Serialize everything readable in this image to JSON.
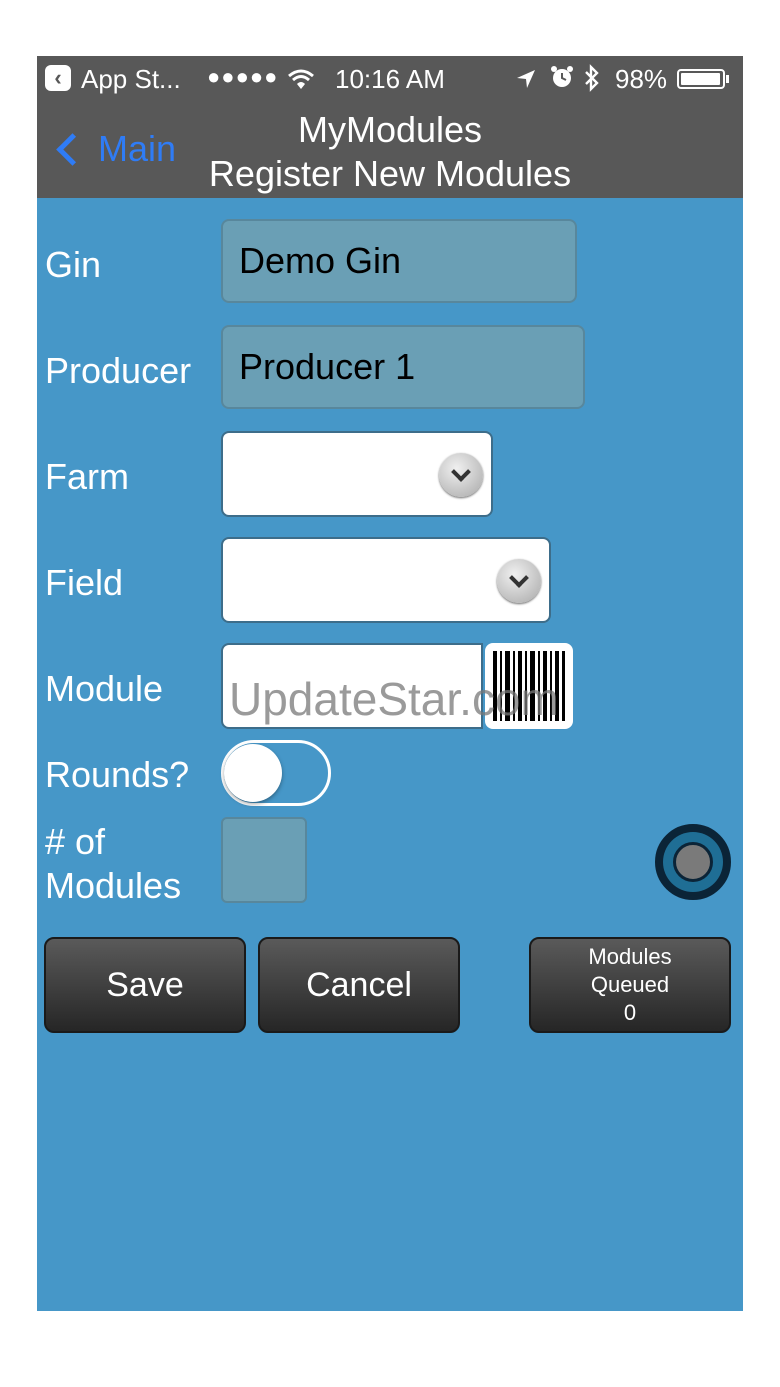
{
  "status_bar": {
    "back_app": "App St...",
    "signal": "●●●●●",
    "time": "10:16 AM",
    "battery_percent": "98%",
    "battery_level": 0.98
  },
  "nav": {
    "back_label": "Main",
    "title": "MyModules",
    "subtitle": "Register New Modules"
  },
  "form": {
    "gin_label": "Gin",
    "gin_value": "Demo Gin",
    "producer_label": "Producer",
    "producer_value": "Producer 1",
    "farm_label": "Farm",
    "farm_value": "",
    "field_label": "Field",
    "field_value": "",
    "module_label": "Module",
    "module_value": "",
    "rounds_label": "Rounds?",
    "rounds_on": false,
    "num_modules_label_line1": "# of",
    "num_modules_label_line2": "Modules",
    "num_modules_value": ""
  },
  "watermark": "UpdateStar.com",
  "buttons": {
    "save": "Save",
    "cancel": "Cancel",
    "queued_line1": "Modules",
    "queued_line2": "Queued",
    "queued_count": "0"
  }
}
